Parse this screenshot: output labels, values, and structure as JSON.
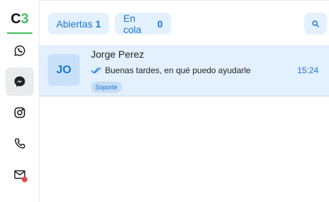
{
  "logo": {
    "part1": "C",
    "part2": "3"
  },
  "rail": {
    "items": [
      {
        "icon": "whatsapp-icon",
        "active": false,
        "badge": false
      },
      {
        "icon": "messenger-icon",
        "active": true,
        "badge": false
      },
      {
        "icon": "instagram-icon",
        "active": false,
        "badge": false
      },
      {
        "icon": "phone-icon",
        "active": false,
        "badge": false
      },
      {
        "icon": "mail-icon",
        "active": false,
        "badge": true
      }
    ]
  },
  "filters": {
    "open": {
      "label": "Abiertas",
      "count": "1"
    },
    "queue": {
      "label": "En cola",
      "count": "0"
    },
    "search_icon": "search-icon"
  },
  "conversations": [
    {
      "initials": "JO",
      "name": "Jorge Perez",
      "last_message": "Buenas tardes, en qué puedo ayudarle",
      "time": "15:24",
      "tag": "Soporte",
      "read_icon": "double-check-icon"
    }
  ],
  "colors": {
    "accent": "#1877d2",
    "accent_bg": "#e3f0fd",
    "brand_green": "#43c15b",
    "badge_red": "#e5484d"
  }
}
